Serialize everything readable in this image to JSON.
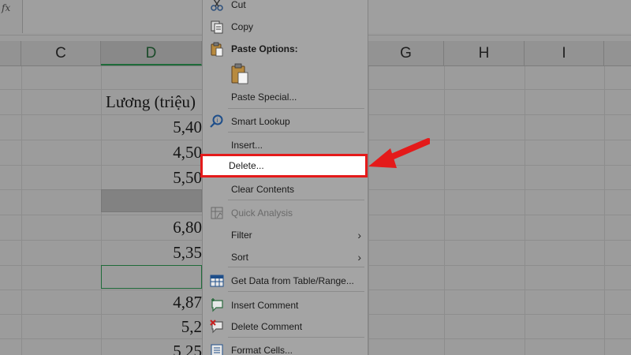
{
  "formula_bar": {
    "fx_label": "fx"
  },
  "columns": [
    {
      "letter": "C",
      "active": false
    },
    {
      "letter": "D",
      "active": true
    },
    {
      "letter": "G",
      "active": false
    },
    {
      "letter": "H",
      "active": false
    },
    {
      "letter": "I",
      "active": false
    }
  ],
  "cells": {
    "header": "Lương (triệu)",
    "values": [
      "5,40",
      "4,50",
      "5,50",
      "",
      "6,80",
      "5,35",
      "",
      "4,87",
      "5,2",
      "5,25"
    ]
  },
  "context_menu": {
    "cut": "Cut",
    "copy": "Copy",
    "paste_options": "Paste Options:",
    "paste_special": "Paste Special...",
    "smart_lookup": "Smart Lookup",
    "insert": "Insert...",
    "delete": "Delete...",
    "clear_contents": "Clear Contents",
    "quick_analysis": "Quick Analysis",
    "filter": "Filter",
    "sort": "Sort",
    "get_data": "Get Data from Table/Range...",
    "insert_comment": "Insert Comment",
    "delete_comment": "Delete Comment",
    "format_cells": "Format Cells..."
  },
  "icons": {
    "cut": "scissors-icon",
    "copy": "copy-icon",
    "paste": "clipboard-icon",
    "smart_lookup": "magnifier-icon",
    "quick_analysis": "quick-analysis-icon",
    "get_data": "table-icon",
    "insert_comment": "comment-add-icon",
    "delete_comment": "comment-delete-icon",
    "format_cells": "format-cells-icon",
    "chevron": "chevron-right-icon"
  },
  "colors": {
    "highlight": "#e41a1a",
    "arrow": "#e41a1a",
    "selection": "#1f6b3a"
  }
}
